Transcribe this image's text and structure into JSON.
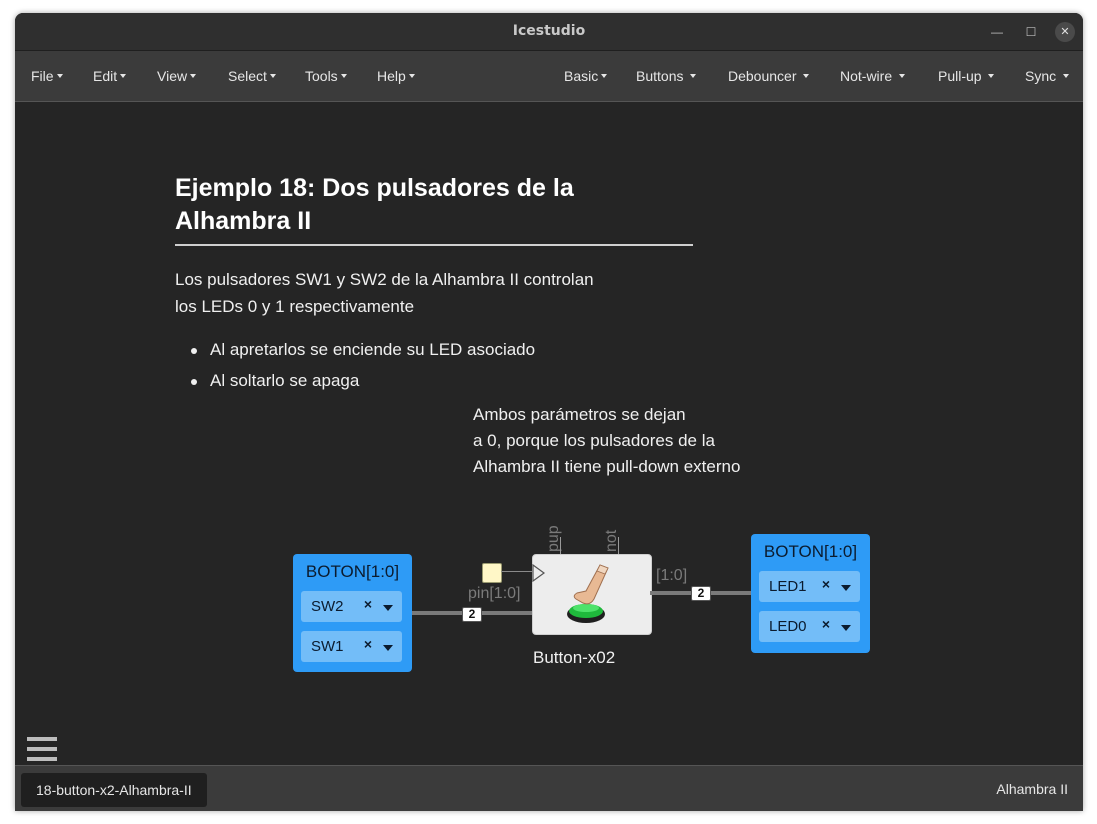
{
  "window": {
    "title": "Icestudio"
  },
  "menubar": {
    "left": [
      {
        "label": "File"
      },
      {
        "label": "Edit"
      },
      {
        "label": "View"
      },
      {
        "label": "Select"
      },
      {
        "label": "Tools"
      },
      {
        "label": "Help"
      }
    ],
    "right": [
      {
        "label": "Basic"
      },
      {
        "label": "Buttons"
      },
      {
        "label": "Debouncer"
      },
      {
        "label": "Not-wire"
      },
      {
        "label": "Pull-up"
      },
      {
        "label": "Sync"
      }
    ]
  },
  "canvas": {
    "heading_line1": "Ejemplo 18: Dos pulsadores de la",
    "heading_line2": "Alhambra II",
    "para_line1": "Los pulsadores SW1 y SW2 de la Alhambra II controlan",
    "para_line2": "los LEDs 0 y 1 respectivamente",
    "bullets": [
      "Al apretarlos se enciende su LED asociado",
      "Al soltarlo se apaga"
    ],
    "note_line1": "Ambos parámetros se dejan",
    "note_line2": "a 0, porque los pulsadores de la",
    "note_line3": "Alhambra II tiene pull-down externo"
  },
  "circuit": {
    "input_block": {
      "title": "BOTON[1:0]",
      "pins": [
        {
          "name": "SW2",
          "remove": "×"
        },
        {
          "name": "SW1",
          "remove": "×"
        }
      ]
    },
    "output_block": {
      "title": "BOTON[1:0]",
      "pins": [
        {
          "name": "LED1",
          "remove": "×"
        },
        {
          "name": "LED0",
          "remove": "×"
        }
      ]
    },
    "component": {
      "name": "Button-x02",
      "input_label": "pin[1:0]",
      "output_label": "[1:0]",
      "param_pup": "pup",
      "param_not": "not"
    },
    "wire_width_label_in": "2",
    "wire_width_label_out": "2"
  },
  "statusbar": {
    "tab": "18-button-x2-Alhambra-II",
    "board": "Alhambra II"
  },
  "colors": {
    "block": "#2e9bf6",
    "pinrow": "#73bdf8",
    "canvas": "#252525",
    "menubar": "#3b3b3b"
  }
}
